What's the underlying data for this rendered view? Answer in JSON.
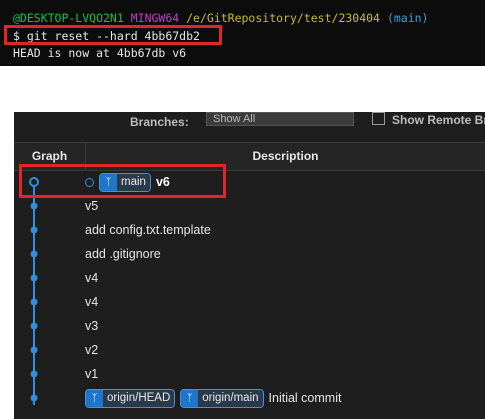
{
  "terminal": {
    "prompt_user": "@DESKTOP-LVQO2N1",
    "prompt_env": "MINGW64",
    "prompt_path": "/e/GitRepository/test/230404",
    "prompt_branch": "(main)",
    "command": "$ git reset --hard 4bb67db2",
    "output": "HEAD is now at 4bb67db v6"
  },
  "filters": {
    "branches_label": "Branches:",
    "branches_value": "Show All",
    "remote_label": "Show Remote Branches"
  },
  "table": {
    "col_graph": "Graph",
    "col_description": "Description"
  },
  "commits": [
    {
      "refs": [
        {
          "name": "main",
          "icon": "branch-icon"
        }
      ],
      "message": "v6",
      "is_head": true
    },
    {
      "refs": [],
      "message": "v5"
    },
    {
      "refs": [],
      "message": "add config.txt.template"
    },
    {
      "refs": [],
      "message": "add .gitignore"
    },
    {
      "refs": [],
      "message": "v4"
    },
    {
      "refs": [],
      "message": "v4"
    },
    {
      "refs": [],
      "message": "v3"
    },
    {
      "refs": [],
      "message": "v2"
    },
    {
      "refs": [],
      "message": "v1"
    },
    {
      "refs": [
        {
          "name": "origin/HEAD",
          "icon": "branch-icon"
        },
        {
          "name": "origin/main",
          "icon": "branch-icon"
        }
      ],
      "message": "Initial commit"
    }
  ],
  "colors": {
    "graph_line": "#2f8fe0",
    "highlight": "#e0262b",
    "ref_badge": "#1d76c9"
  }
}
